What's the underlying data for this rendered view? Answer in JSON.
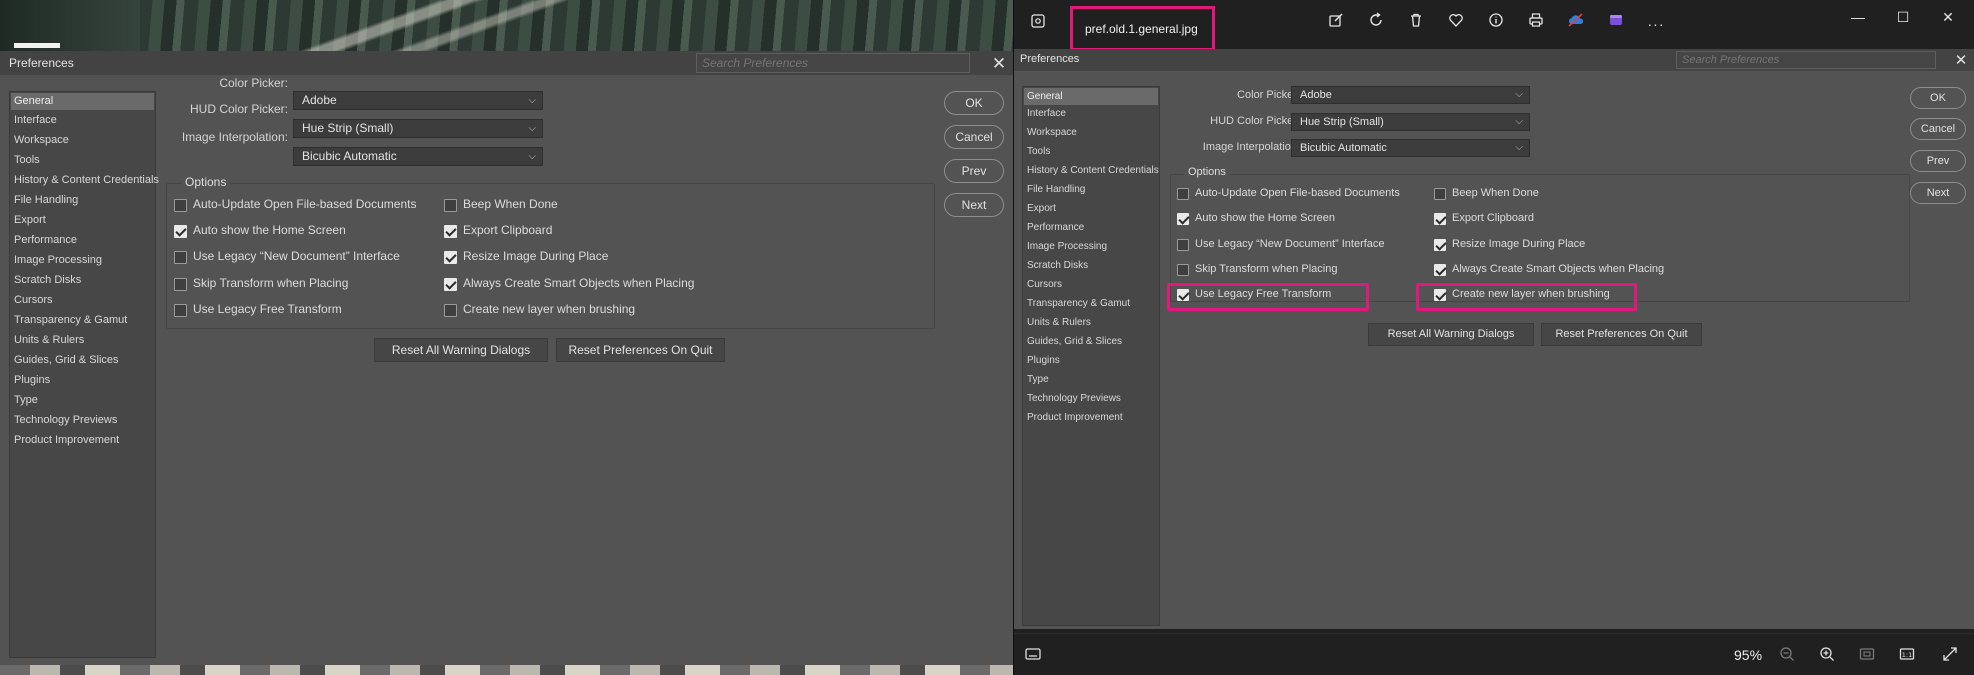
{
  "left": {
    "dialog_title": "Preferences",
    "search_placeholder": "Search Preferences",
    "sidebar": [
      "General",
      "Interface",
      "Workspace",
      "Tools",
      "History & Content Credentials",
      "File Handling",
      "Export",
      "Performance",
      "Image Processing",
      "Scratch Disks",
      "Cursors",
      "Transparency & Gamut",
      "Units & Rulers",
      "Guides, Grid & Slices",
      "Plugins",
      "Type",
      "Technology Previews",
      "Product Improvement"
    ],
    "selected": "General",
    "fields": [
      {
        "label": "Color Picker:",
        "value": "Adobe"
      },
      {
        "label": "HUD Color Picker:",
        "value": "Hue Strip (Small)"
      },
      {
        "label": "Image Interpolation:",
        "value": "Bicubic Automatic"
      }
    ],
    "options_title": "Options",
    "options_left": [
      {
        "label": "Auto-Update Open File-based Documents",
        "checked": false
      },
      {
        "label": "Auto show the Home Screen",
        "checked": true
      },
      {
        "label": "Use Legacy “New Document” Interface",
        "checked": false
      },
      {
        "label": "Skip Transform when Placing",
        "checked": false
      },
      {
        "label": "Use Legacy Free Transform",
        "checked": false
      }
    ],
    "options_right": [
      {
        "label": "Beep When Done",
        "checked": false
      },
      {
        "label": "Export Clipboard",
        "checked": true
      },
      {
        "label": "Resize Image During Place",
        "checked": true
      },
      {
        "label": "Always Create Smart Objects when Placing",
        "checked": true
      },
      {
        "label": "Create new layer when brushing",
        "checked": false
      }
    ],
    "buttons": [
      "OK",
      "Cancel",
      "Prev",
      "Next"
    ],
    "reset_warning": "Reset All Warning Dialogs",
    "reset_prefs": "Reset Preferences On Quit"
  },
  "right": {
    "filename": "pref.old.1.general.jpg",
    "toolbar_icons": [
      "edit-icon",
      "rotate-icon",
      "delete-icon",
      "favorite-icon",
      "info-icon",
      "print-icon",
      "onedrive-icon",
      "clipchamp-icon",
      "more-icon"
    ],
    "more_label": "···",
    "dialog_title": "Preferences",
    "search_placeholder": "Search Preferences",
    "sidebar": [
      "General",
      "Interface",
      "Workspace",
      "Tools",
      "History & Content Credentials",
      "File Handling",
      "Export",
      "Performance",
      "Image Processing",
      "Scratch Disks",
      "Cursors",
      "Transparency & Gamut",
      "Units & Rulers",
      "Guides, Grid & Slices",
      "Plugins",
      "Type",
      "Technology Previews",
      "Product Improvement"
    ],
    "selected": "General",
    "fields": [
      {
        "label": "Color Picker:",
        "value": "Adobe"
      },
      {
        "label": "HUD Color Picker:",
        "value": "Hue Strip (Small)"
      },
      {
        "label": "Image Interpolation:",
        "value": "Bicubic Automatic"
      }
    ],
    "options_title": "Options",
    "options_left": [
      {
        "label": "Auto-Update Open File-based Documents",
        "checked": false
      },
      {
        "label": "Auto show the Home Screen",
        "checked": true
      },
      {
        "label": "Use Legacy “New Document” Interface",
        "checked": false
      },
      {
        "label": "Skip Transform when Placing",
        "checked": false
      },
      {
        "label": "Use Legacy Free Transform",
        "checked": true
      }
    ],
    "options_right": [
      {
        "label": "Beep When Done",
        "checked": false
      },
      {
        "label": "Export Clipboard",
        "checked": true
      },
      {
        "label": "Resize Image During Place",
        "checked": true
      },
      {
        "label": "Always Create Smart Objects when Placing",
        "checked": true
      },
      {
        "label": "Create new layer when brushing",
        "checked": true
      }
    ],
    "buttons": [
      "OK",
      "Cancel",
      "Prev",
      "Next"
    ],
    "reset_warning": "Reset All Warning Dialogs",
    "reset_prefs": "Reset Preferences On Quit",
    "zoom": "95%",
    "highlight_color": "#e0197e"
  }
}
